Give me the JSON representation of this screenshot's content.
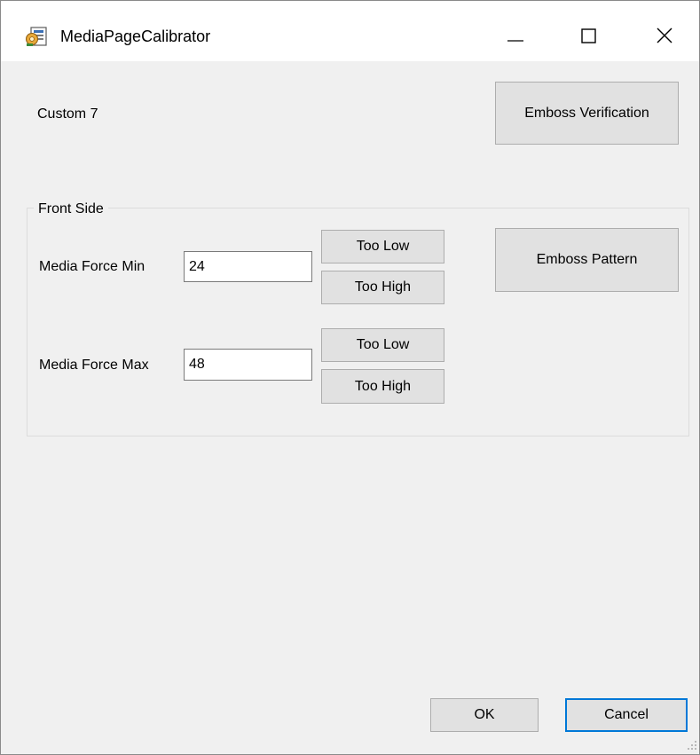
{
  "window": {
    "title": "MediaPageCalibrator",
    "icon": "calibrator-app-icon",
    "controls": {
      "minimize_icon": "minimize-icon",
      "maximize_icon": "maximize-icon",
      "close_icon": "close-icon"
    }
  },
  "profile_label": "Custom 7",
  "emboss_verification_label": "Emboss Verification",
  "front_side": {
    "title": "Front Side",
    "min": {
      "label": "Media Force Min",
      "value": "24",
      "too_low_label": "Too Low",
      "too_high_label": "Too High"
    },
    "max": {
      "label": "Media Force Max",
      "value": "48",
      "too_low_label": "Too Low",
      "too_high_label": "Too High"
    },
    "emboss_pattern_label": "Emboss Pattern"
  },
  "footer": {
    "ok_label": "OK",
    "cancel_label": "Cancel"
  },
  "colors": {
    "dialog_bg": "#f0f0f0",
    "titlebar_bg": "#ffffff",
    "button_bg": "#e1e1e1",
    "default_button_border": "#0078d7"
  }
}
